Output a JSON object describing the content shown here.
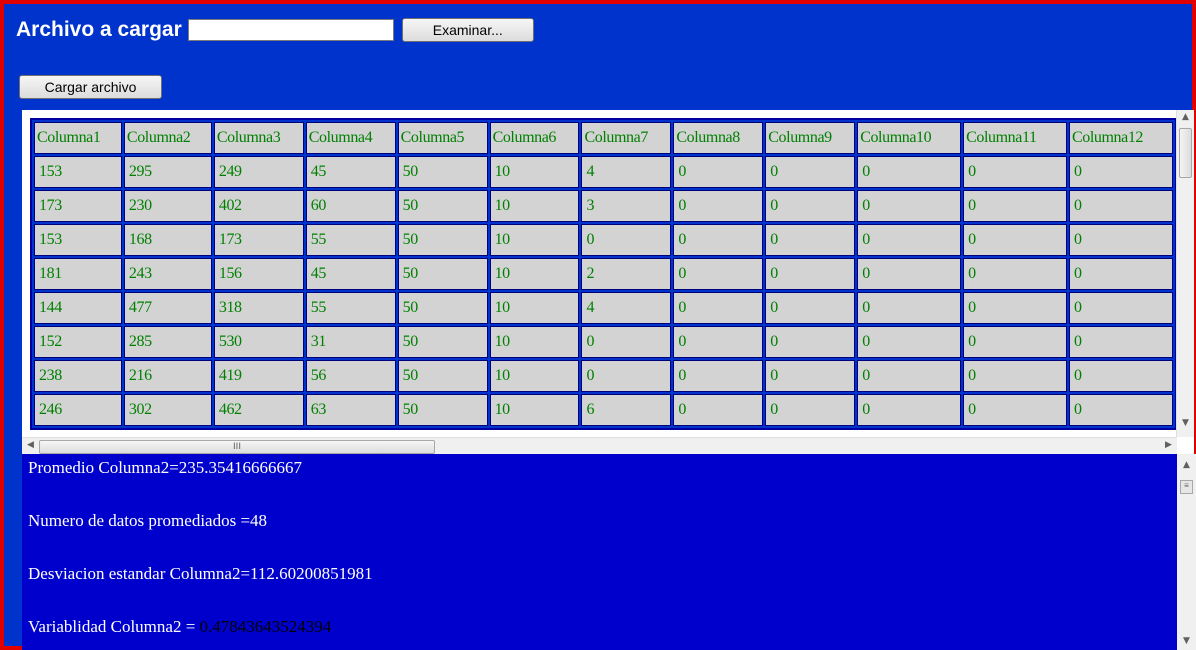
{
  "upload": {
    "title": "Archivo a cargar",
    "file_value": "",
    "browse_label": "Examinar...",
    "submit_label": "Cargar archivo"
  },
  "table": {
    "headers": [
      "Columna1",
      "Columna2",
      "Columna3",
      "Columna4",
      "Columna5",
      "Columna6",
      "Columna7",
      "Columna8",
      "Columna9",
      "Columna10",
      "Columna11",
      "Columna12"
    ],
    "rows": [
      [
        "153",
        "295",
        "249",
        "45",
        "50",
        "10",
        "4",
        "0",
        "0",
        "0",
        "0",
        "0"
      ],
      [
        "173",
        "230",
        "402",
        "60",
        "50",
        "10",
        "3",
        "0",
        "0",
        "0",
        "0",
        "0"
      ],
      [
        "153",
        "168",
        "173",
        "55",
        "50",
        "10",
        "0",
        "0",
        "0",
        "0",
        "0",
        "0"
      ],
      [
        "181",
        "243",
        "156",
        "45",
        "50",
        "10",
        "2",
        "0",
        "0",
        "0",
        "0",
        "0"
      ],
      [
        "144",
        "477",
        "318",
        "55",
        "50",
        "10",
        "4",
        "0",
        "0",
        "0",
        "0",
        "0"
      ],
      [
        "152",
        "285",
        "530",
        "31",
        "50",
        "10",
        "0",
        "0",
        "0",
        "0",
        "0",
        "0"
      ],
      [
        "238",
        "216",
        "419",
        "56",
        "50",
        "10",
        "0",
        "0",
        "0",
        "0",
        "0",
        "0"
      ],
      [
        "246",
        "302",
        "462",
        "63",
        "50",
        "10",
        "6",
        "0",
        "0",
        "0",
        "0",
        "0"
      ]
    ]
  },
  "scrollbar": {
    "thumb_grip": "III"
  },
  "stats": {
    "promedio": "Promedio Columna2=235.35416666667",
    "numero": "Numero de datos promediados =48",
    "desviacion": "Desviacion estandar Columna2=112.60200851981",
    "variabilidad_label": "Variablidad Columna2 = ",
    "variabilidad_value": "0.47843643524394"
  },
  "colors": {
    "frame_border": "#e00000",
    "page_bg": "#0033cc",
    "stats_bg": "#0000cc",
    "cell_bg": "#d3d3d3",
    "cell_text": "#008000"
  }
}
